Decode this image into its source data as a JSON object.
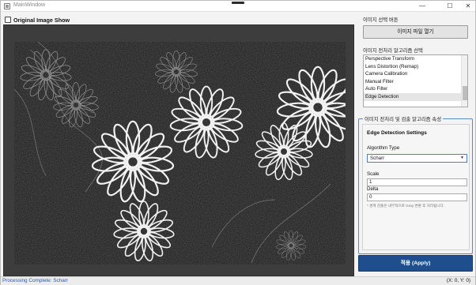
{
  "window": {
    "title": "MainWindow",
    "minimize": "—",
    "maximize": "☐",
    "close": "✕"
  },
  "left": {
    "original_checkbox_label": "Original Image Show",
    "original_checked": false
  },
  "right": {
    "file_section_label": "이미지 선택 버튼",
    "open_button": "이미지 파일 열기",
    "algo_section_label": "이미지 전처리 알고리즘 선택",
    "algorithms": [
      "Perspective Transform",
      "Lens Distortion (Remap)",
      "Camera Calibration",
      "Manual Filter",
      "Auto Filter",
      "Edge Detection"
    ],
    "selected_algorithm": "Edge Detection",
    "props_legend": "이미지 전처리 및 검출 알고리즘 속성",
    "props_title": "Edge Detection Settings",
    "algorithm_type_label": "Algorithm Type",
    "algorithm_type_value": "Scharr",
    "scale_label": "Scale",
    "scale_value": "1",
    "delta_label": "Delta",
    "delta_value": "0",
    "note": "* 경계 검출은 내부적으로 Gray 변환 후 처리됩니다.",
    "apply_button": "적용 (Apply)"
  },
  "status": {
    "message": "Processing Complete: Scharr",
    "coords": "(X: 0, Y: 0)"
  },
  "colors": {
    "accent": "#1f4e8c",
    "status_text": "#2a5aa8",
    "group_border": "#5c8bc0"
  }
}
